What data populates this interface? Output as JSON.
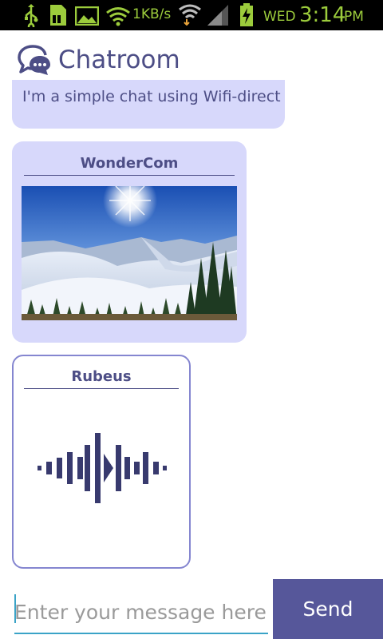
{
  "status_bar": {
    "speed": "1KB/s",
    "day": "WED",
    "time": "3:14",
    "ampm": "PM",
    "icons": [
      "usb-icon",
      "sd-card-icon",
      "image-icon",
      "wifi-icon",
      "wifi-data-icon",
      "signal-icon",
      "battery-charging-icon"
    ]
  },
  "header": {
    "title": "Chatroom",
    "icon": "chat-bubbles-icon"
  },
  "messages": [
    {
      "type": "text",
      "body": "I'm a simple chat using Wifi-direct"
    },
    {
      "type": "image",
      "sender": "WonderCom",
      "image": "snowy-mountain-photo"
    },
    {
      "type": "audio",
      "sender": "Rubeus",
      "icon": "audio-waveform-play-icon"
    }
  ],
  "composer": {
    "placeholder": "Enter your message here",
    "value": "",
    "send_label": "Send"
  },
  "colors": {
    "accent": "#4d4e86",
    "bubble": "#d7d8fb",
    "send_button": "#56579a",
    "status_green": "#9ccc3c",
    "input_underline": "#3aa3c7"
  }
}
